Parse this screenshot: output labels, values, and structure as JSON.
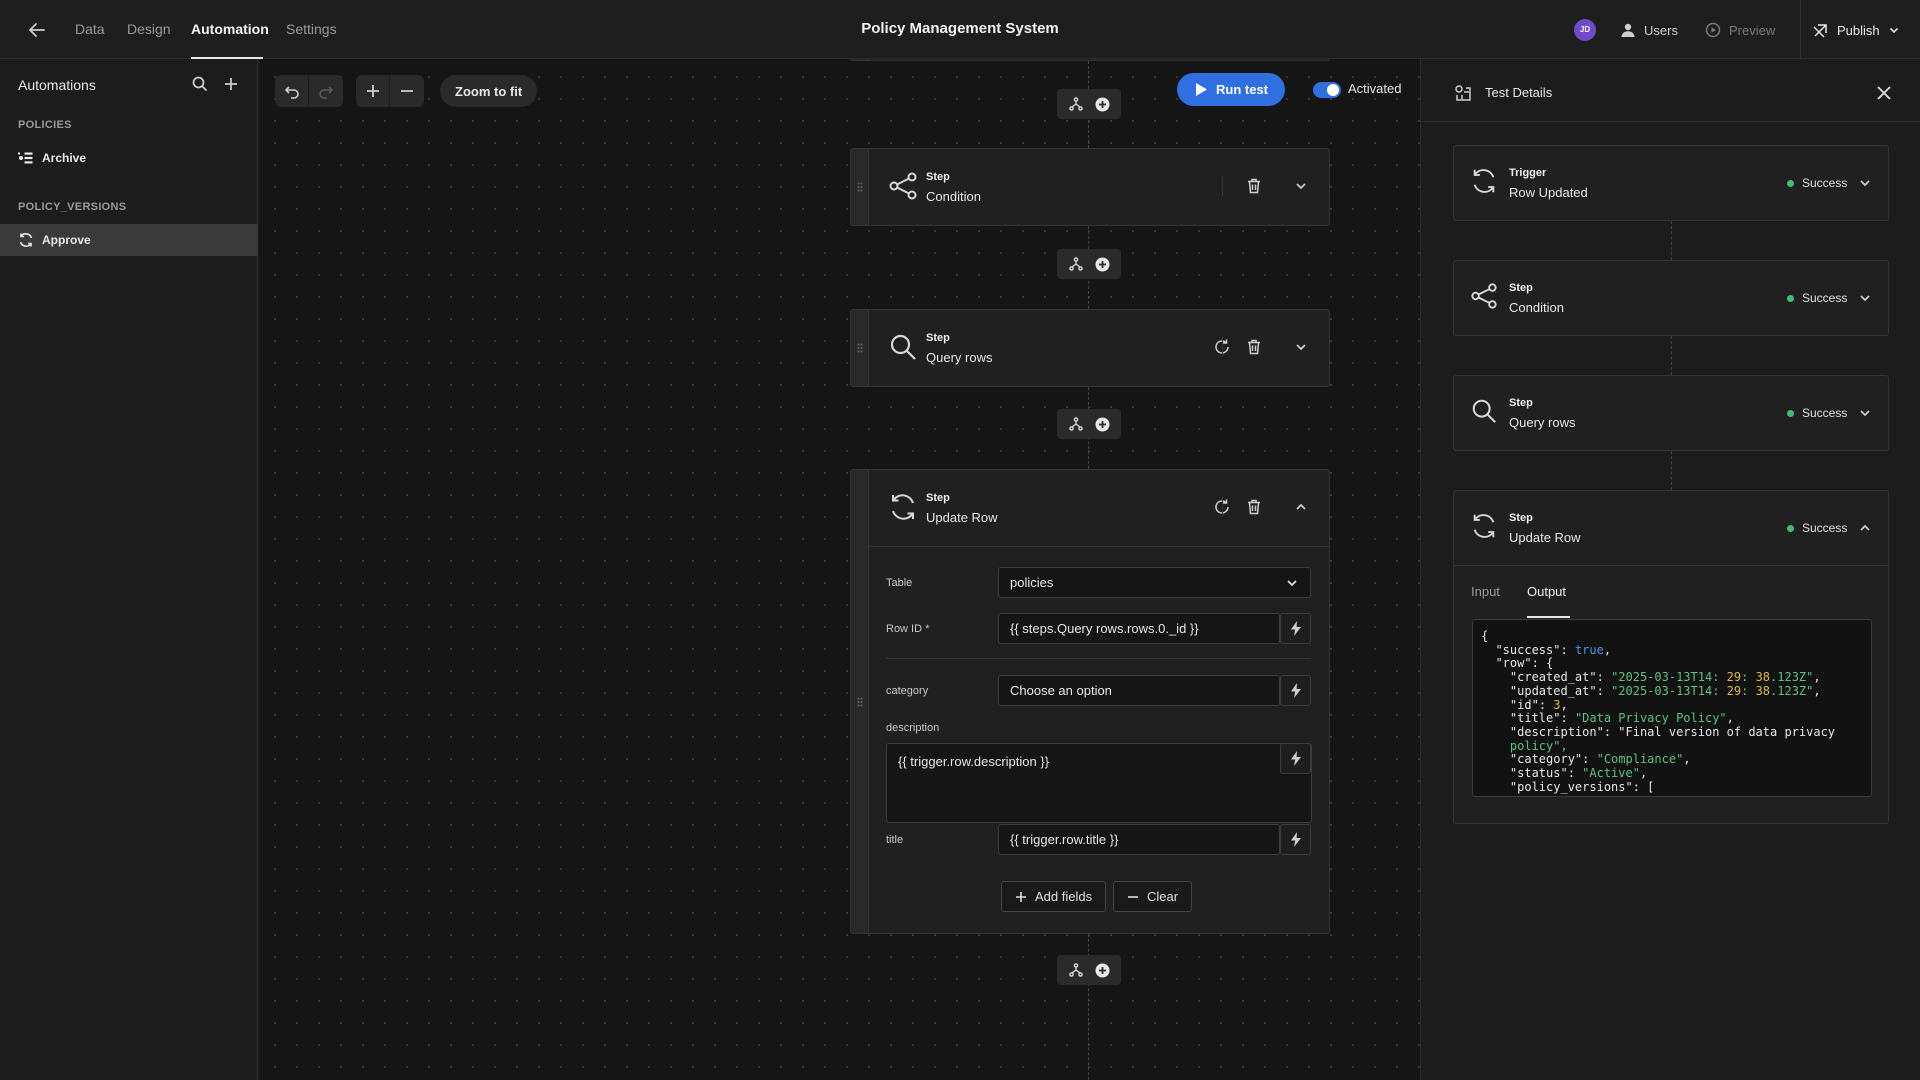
{
  "topbar": {
    "tabs": [
      "Data",
      "Design",
      "Automation",
      "Settings"
    ],
    "title": "Policy Management System",
    "avatar_initials": "JD",
    "users_label": "Users",
    "preview_label": "Preview",
    "publish_label": "Publish"
  },
  "sidebar": {
    "title": "Automations",
    "sections": [
      {
        "label": "POLICIES",
        "items": [
          "Archive"
        ]
      },
      {
        "label": "POLICY_VERSIONS",
        "items": [
          "Approve"
        ]
      }
    ]
  },
  "canvas": {
    "zoom_to_fit": "Zoom to fit",
    "run_test": "Run test",
    "activated_label": "Activated",
    "activated": true,
    "steps": [
      {
        "kicker": "Step",
        "name": "Condition",
        "icon": "branch-icon"
      },
      {
        "kicker": "Step",
        "name": "Query rows",
        "icon": "search-icon"
      },
      {
        "kicker": "Step",
        "name": "Update Row",
        "icon": "refresh-icon"
      }
    ],
    "update_form": {
      "table_label": "Table",
      "table_value": "policies",
      "row_id_label": "Row ID *",
      "row_id_value": "{{ steps.Query rows.rows.0._id }}",
      "category_label": "category",
      "category_placeholder": "Choose an option",
      "description_label": "description",
      "description_value": "{{ trigger.row.description }}",
      "title_label": "title",
      "title_value": "{{ trigger.row.title }}",
      "add_fields": "Add fields",
      "clear": "Clear"
    }
  },
  "test_panel": {
    "title": "Test Details",
    "cards": [
      {
        "kicker": "Trigger",
        "name": "Row Updated",
        "status": "Success",
        "icon": "refresh-icon"
      },
      {
        "kicker": "Step",
        "name": "Condition",
        "status": "Success",
        "icon": "branch-icon"
      },
      {
        "kicker": "Step",
        "name": "Query rows",
        "status": "Success",
        "icon": "search-icon"
      },
      {
        "kicker": "Step",
        "name": "Update Row",
        "status": "Success",
        "icon": "refresh-icon"
      }
    ],
    "tabs": [
      "Input",
      "Output"
    ],
    "active_tab": "Output",
    "output_lines": [
      "{",
      "  \"success\": true,",
      "  \"row\": {",
      "    \"created_at\": \"2025-03-13T14:29:38.123Z\",",
      "    \"updated_at\": \"2025-03-13T14:29:38.123Z\",",
      "    \"id\": 3,",
      "    \"title\": \"Data Privacy Policy\",",
      "    \"description\": \"Final version of data privacy",
      "    policy\",",
      "    \"category\": \"Compliance\",",
      "    \"status\": \"Active\",",
      "    \"policy_versions\": ["
    ]
  },
  "colors": {
    "accent": "#2f6fe0",
    "success": "#3fbf6f",
    "avatar": "#6f4bc7"
  }
}
